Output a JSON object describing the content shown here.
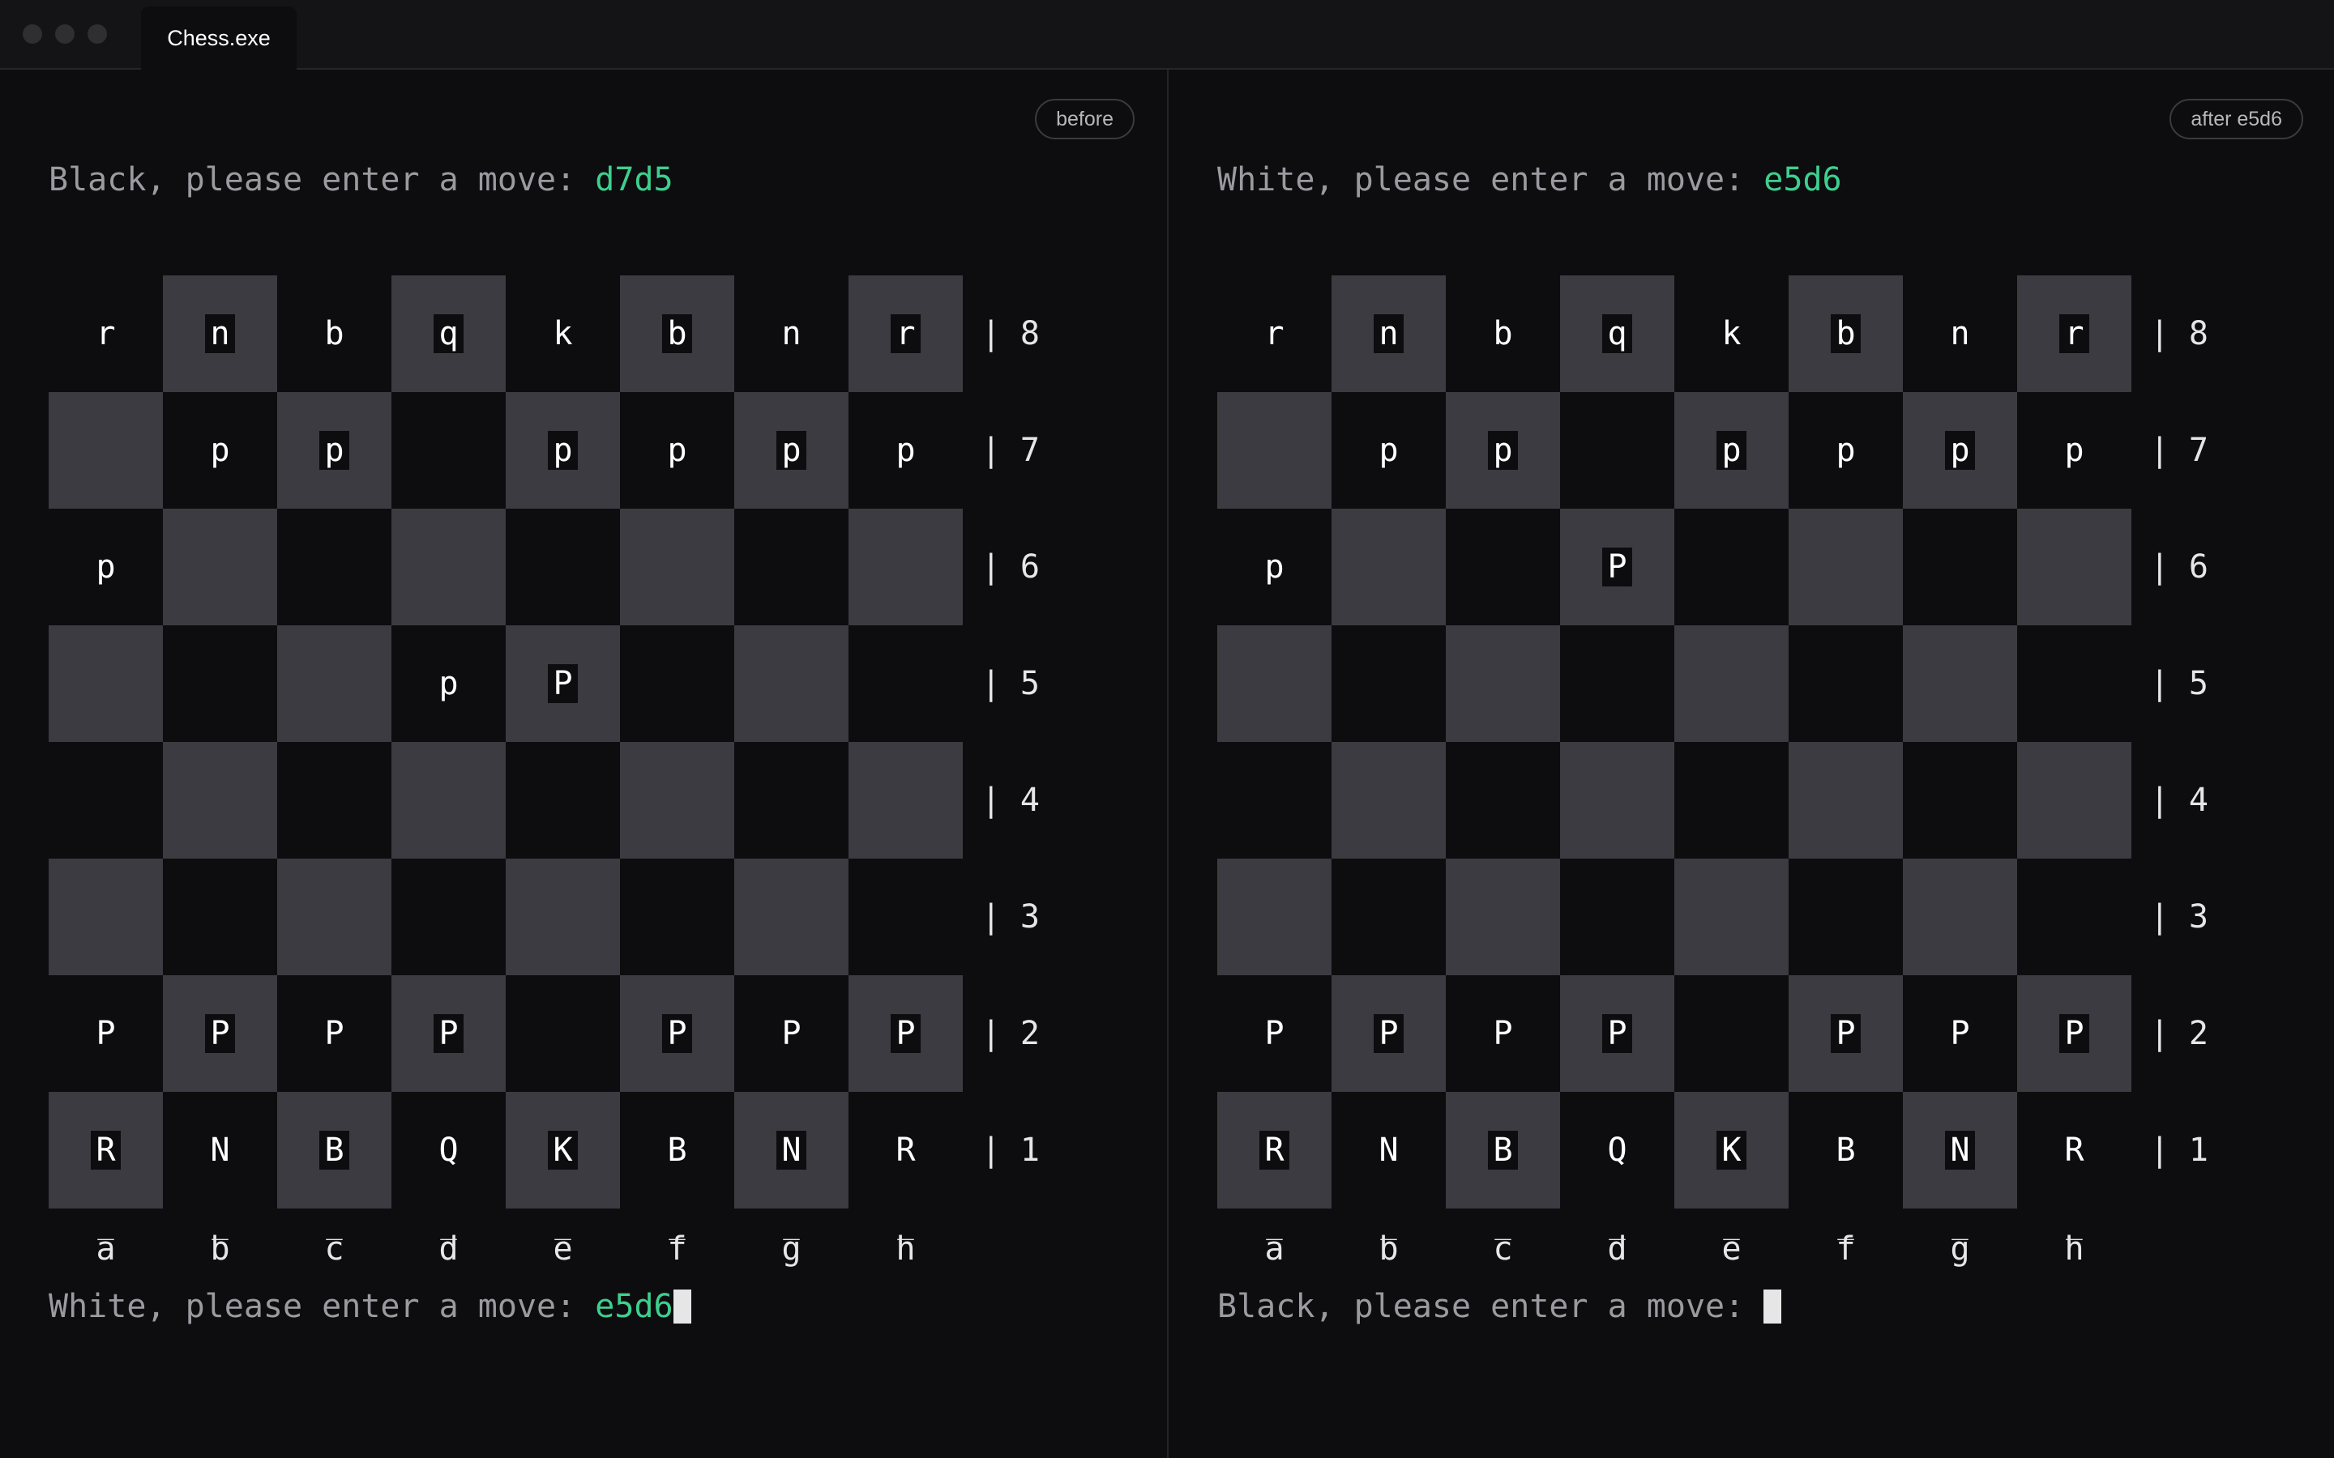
{
  "window": {
    "tab_title": "Chess.exe"
  },
  "files": [
    "a",
    "b",
    "c",
    "d",
    "e",
    "f",
    "g",
    "h"
  ],
  "file_underline": "_",
  "panes": [
    {
      "badge": "before",
      "prompt_top": {
        "text": "Black, please enter a move: ",
        "move": "d7d5"
      },
      "prompt_bottom": {
        "text": "White, please enter a move: ",
        "move": "e5d6"
      },
      "ranks": [
        "| 8",
        "| 7",
        "| 6",
        "| 5",
        "| 4",
        "| 3",
        "| 2",
        "| 1"
      ],
      "board": [
        [
          "r",
          "n",
          "b",
          "q",
          "k",
          "b",
          "n",
          "r"
        ],
        [
          "",
          "p",
          "p",
          "",
          "p",
          "p",
          "p",
          "p"
        ],
        [
          "p",
          "",
          "",
          "",
          "",
          "",
          "",
          ""
        ],
        [
          "",
          "",
          "",
          "p",
          "P",
          "",
          "",
          ""
        ],
        [
          "",
          "",
          "",
          "",
          "",
          "",
          "",
          ""
        ],
        [
          "",
          "",
          "",
          "",
          "",
          "",
          "",
          ""
        ],
        [
          "P",
          "P",
          "P",
          "P",
          "",
          "P",
          "P",
          "P"
        ],
        [
          "R",
          "N",
          "B",
          "Q",
          "K",
          "B",
          "N",
          "R"
        ]
      ]
    },
    {
      "badge": "after e5d6",
      "prompt_top": {
        "text": "White, please enter a move: ",
        "move": "e5d6"
      },
      "prompt_bottom": {
        "text": "Black, please enter a move: ",
        "move": ""
      },
      "ranks": [
        "| 8",
        "| 7",
        "| 6",
        "| 5",
        "| 4",
        "| 3",
        "| 2",
        "| 1"
      ],
      "board": [
        [
          "r",
          "n",
          "b",
          "q",
          "k",
          "b",
          "n",
          "r"
        ],
        [
          "",
          "p",
          "p",
          "",
          "p",
          "p",
          "p",
          "p"
        ],
        [
          "p",
          "",
          "",
          "P",
          "",
          "",
          "",
          ""
        ],
        [
          "",
          "",
          "",
          "",
          "",
          "",
          "",
          ""
        ],
        [
          "",
          "",
          "",
          "",
          "",
          "",
          "",
          ""
        ],
        [
          "",
          "",
          "",
          "",
          "",
          "",
          "",
          ""
        ],
        [
          "P",
          "P",
          "P",
          "P",
          "",
          "P",
          "P",
          "P"
        ],
        [
          "R",
          "N",
          "B",
          "Q",
          "K",
          "B",
          "N",
          "R"
        ]
      ]
    }
  ]
}
